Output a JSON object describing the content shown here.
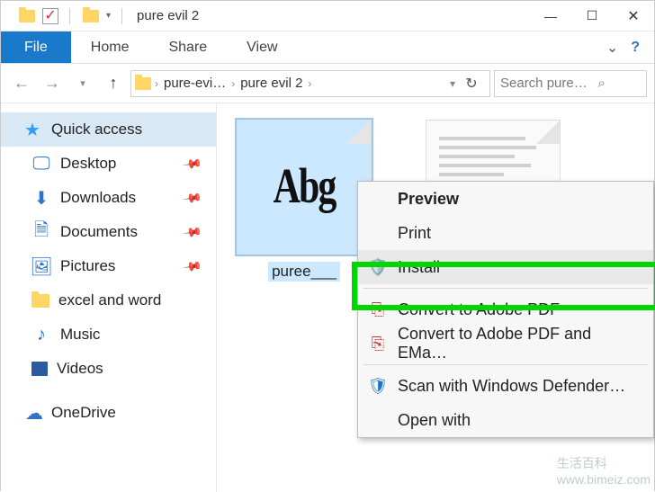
{
  "titlebar": {
    "title": "pure evil 2"
  },
  "ribbon": {
    "file": "File",
    "tabs": [
      "Home",
      "Share",
      "View"
    ]
  },
  "nav": {
    "crumb1": "pure-evi…",
    "crumb2": "pure evil 2",
    "search_placeholder": "Search pure…"
  },
  "sidebar": {
    "quick_access": "Quick access",
    "items": [
      {
        "label": "Desktop",
        "pinned": true
      },
      {
        "label": "Downloads",
        "pinned": true
      },
      {
        "label": "Documents",
        "pinned": true
      },
      {
        "label": "Pictures",
        "pinned": true
      },
      {
        "label": "excel and word",
        "pinned": false
      },
      {
        "label": "Music",
        "pinned": false
      },
      {
        "label": "Videos",
        "pinned": false
      }
    ],
    "onedrive": "OneDrive"
  },
  "content": {
    "file1": {
      "label": "puree___",
      "preview_text": "Abg"
    }
  },
  "context_menu": {
    "preview": "Preview",
    "print": "Print",
    "install": "Install",
    "convert_pdf": "Convert to Adobe PDF",
    "convert_pdf_email": "Convert to Adobe PDF and EMa…",
    "scan_defender": "Scan with Windows Defender…",
    "open_with": "Open with"
  },
  "watermark": {
    "line1": "生活百科",
    "line2": "www.bimeiz.com"
  }
}
